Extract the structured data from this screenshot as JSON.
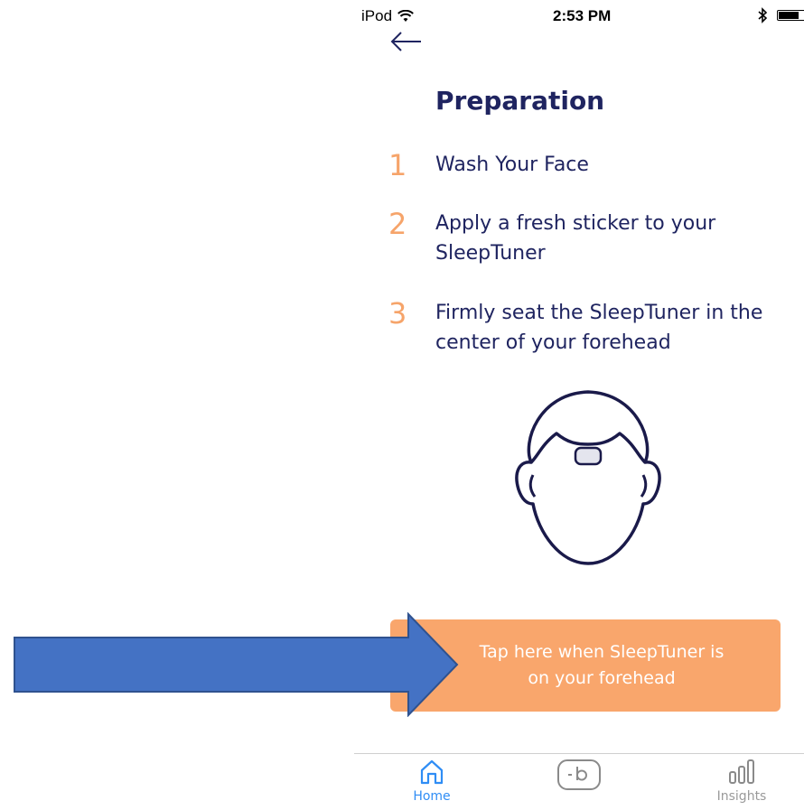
{
  "status_bar": {
    "carrier": "iPod",
    "time": "2:53 PM"
  },
  "header": {
    "back_icon": "arrow-left-icon",
    "title": "Preparation"
  },
  "steps": [
    {
      "number": "1",
      "text": "Wash Your Face"
    },
    {
      "number": "2",
      "text": "Apply a fresh sticker to your SleepTuner"
    },
    {
      "number": "3",
      "text": "Firmly seat the SleepTuner in the center of your forehead"
    }
  ],
  "illustration": {
    "icon": "head-with-device-icon"
  },
  "cta": {
    "label": "Tap here when SleepTuner is on your forehead"
  },
  "tab_bar": {
    "tabs": [
      {
        "label": "Home",
        "icon": "home-icon",
        "active": true
      },
      {
        "label": "",
        "icon": "sleeptuner-device-icon",
        "active": false
      },
      {
        "label": "Insights",
        "icon": "bar-chart-icon",
        "active": false
      }
    ]
  },
  "colors": {
    "title": "#1f2460",
    "step_number": "#f6a46a",
    "cta_background": "#f9a66c",
    "active_tab": "#2f8df5",
    "inactive_tab": "#9a9a9a",
    "overlay_arrow": "#4472c4"
  }
}
